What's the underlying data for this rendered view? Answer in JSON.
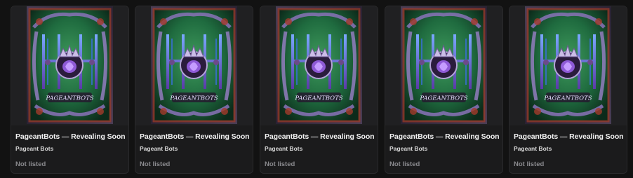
{
  "cards": [
    {
      "title": "PageantBots — Revealing Soon",
      "collection": "Pageant Bots",
      "status": "Not listed",
      "art_label": "PAGEANTBOTS"
    },
    {
      "title": "PageantBots — Revealing Soon",
      "collection": "Pageant Bots",
      "status": "Not listed",
      "art_label": "PAGEANTBOTS"
    },
    {
      "title": "PageantBots — Revealing Soon",
      "collection": "Pageant Bots",
      "status": "Not listed",
      "art_label": "PAGEANTBOTS"
    },
    {
      "title": "PageantBots — Revealing Soon",
      "collection": "Pageant Bots",
      "status": "Not listed",
      "art_label": "PAGEANTBOTS"
    },
    {
      "title": "PageantBots — Revealing Soon",
      "collection": "Pageant Bots",
      "status": "Not listed",
      "art_label": "PAGEANTBOTS"
    }
  ],
  "colors": {
    "page_bg": "#121212",
    "card_bg": "#1b1b1c",
    "title_text": "#f2f2f2",
    "muted_text": "#8a8a8e",
    "art_green": "#1f6b3f",
    "art_purple": "#5b3aa8",
    "art_blue": "#3a6fd8",
    "art_red": "#a33a2a"
  }
}
